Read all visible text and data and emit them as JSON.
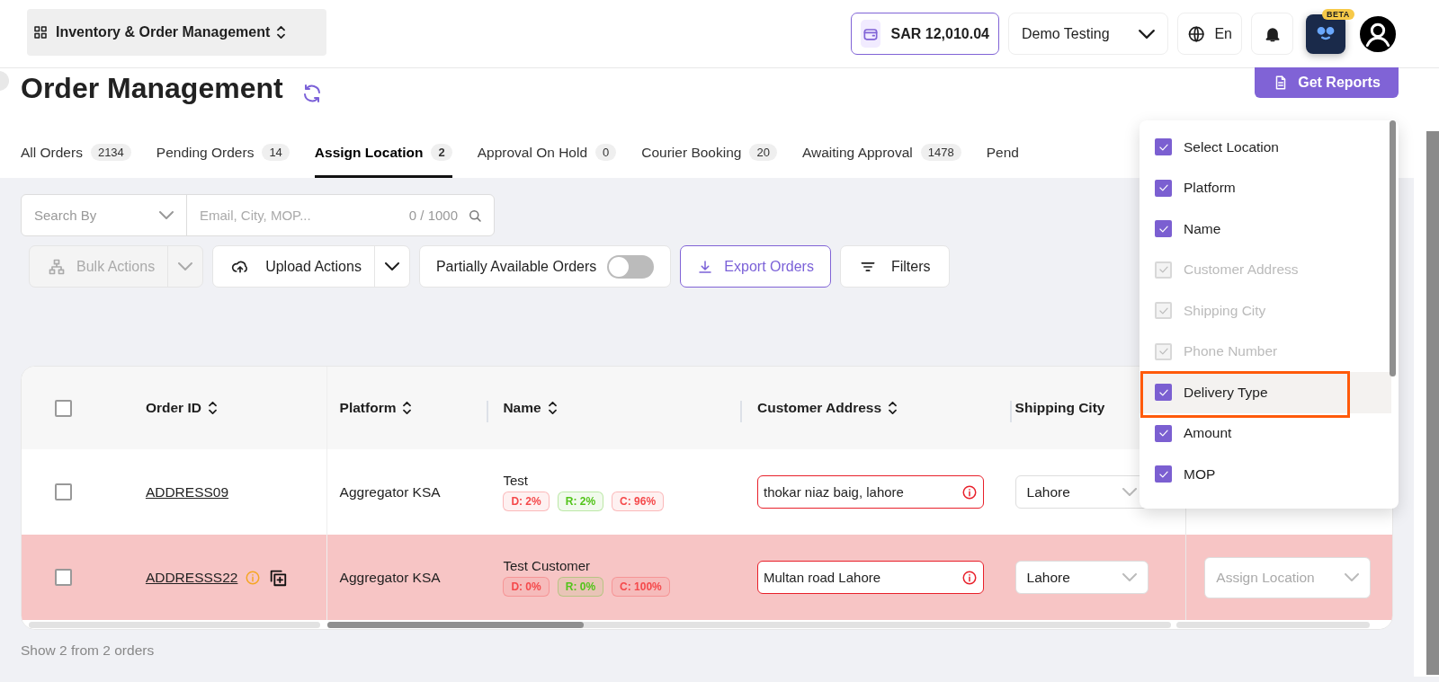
{
  "header": {
    "app_switcher": "Inventory & Order Management",
    "balance": "SAR 12,010.04",
    "account": "Demo Testing",
    "language": "En",
    "assistant_badge": "BETA"
  },
  "page": {
    "title": "Order Management",
    "report_button": "Get Reports"
  },
  "tabs": [
    {
      "label": "All Orders",
      "count": "2134",
      "selected": false
    },
    {
      "label": "Pending Orders",
      "count": "14",
      "selected": false
    },
    {
      "label": "Assign Location",
      "count": "2",
      "selected": true
    },
    {
      "label": "Approval On Hold",
      "count": "0",
      "selected": false
    },
    {
      "label": "Courier Booking",
      "count": "20",
      "selected": false
    },
    {
      "label": "Awaiting Approval",
      "count": "1478",
      "selected": false
    },
    {
      "label": "Pend",
      "selected": false
    }
  ],
  "search": {
    "by_placeholder": "Search By",
    "placeholder": "Email, City, MOP...",
    "counter": "0 / 1000"
  },
  "actions": {
    "bulk_actions": {
      "label": "Bulk Actions",
      "disabled": true
    },
    "upload_actions": "Upload Actions",
    "partial_toggle": {
      "label": "Partially Available Orders",
      "on": false
    },
    "export": "Export Orders",
    "filters": "Filters"
  },
  "table": {
    "select_all": false,
    "columns": [
      "Order ID",
      "Platform",
      "Name",
      "Customer Address",
      "Shipping City"
    ],
    "rows": [
      {
        "selected": false,
        "flagged": false,
        "order_id": "ADDRESS09",
        "platform": "Aggregator KSA",
        "name": "Test",
        "badges": [
          {
            "text": "D: 2%",
            "color": "#f5494b"
          },
          {
            "text": "R: 2%",
            "color": "#52c41a"
          },
          {
            "text": "C: 96%",
            "color": "#f5494b"
          }
        ],
        "address": "thokar niaz baig, lahore",
        "address_error": true,
        "city": "Lahore"
      },
      {
        "selected": false,
        "flagged": true,
        "order_id": "ADDRESSS22",
        "platform": "Aggregator KSA",
        "name": "Test Customer",
        "badges": [
          {
            "text": "D: 0%",
            "color": "#f5494b"
          },
          {
            "text": "R: 0%",
            "color": "#52c41a"
          },
          {
            "text": "C: 100%",
            "color": "#f5494b"
          }
        ],
        "address": "Multan road Lahore",
        "address_error": true,
        "city": "Lahore",
        "location_placeholder": "Assign Location"
      }
    ],
    "footer": "Show 2 from 2 orders"
  },
  "column_menu": {
    "items": [
      {
        "label": "Select Location",
        "checked": true,
        "disabled": false,
        "highlighted": false
      },
      {
        "label": "Platform",
        "checked": true,
        "disabled": false,
        "highlighted": false
      },
      {
        "label": "Name",
        "checked": true,
        "disabled": false,
        "highlighted": false
      },
      {
        "label": "Customer Address",
        "checked": true,
        "disabled": true,
        "highlighted": false
      },
      {
        "label": "Shipping City",
        "checked": true,
        "disabled": true,
        "highlighted": false
      },
      {
        "label": "Phone Number",
        "checked": true,
        "disabled": true,
        "highlighted": false
      },
      {
        "label": "Delivery Type",
        "checked": true,
        "disabled": false,
        "highlighted": true
      },
      {
        "label": "Amount",
        "checked": true,
        "disabled": false,
        "highlighted": false
      },
      {
        "label": "MOP",
        "checked": true,
        "disabled": false,
        "highlighted": false
      }
    ]
  }
}
